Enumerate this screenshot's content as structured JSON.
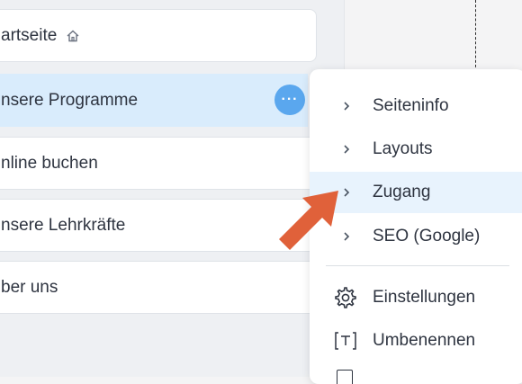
{
  "sidebar": {
    "pages": [
      {
        "label": "artseite",
        "home": true
      },
      {
        "label": "nsere Programme",
        "selected": true
      },
      {
        "label": "nline buchen"
      },
      {
        "label": "nsere Lehrkräfte"
      },
      {
        "label": "ber uns"
      }
    ],
    "more_label": "···"
  },
  "context_menu": {
    "items": [
      {
        "label": "Seiteninfo",
        "icon": "chevron-right-icon"
      },
      {
        "label": "Layouts",
        "icon": "chevron-right-icon"
      },
      {
        "label": "Zugang",
        "icon": "chevron-right-icon",
        "highlighted": true
      },
      {
        "label": "SEO (Google)",
        "icon": "chevron-right-icon"
      },
      {
        "label": "Einstellungen",
        "icon": "gear-icon"
      },
      {
        "label": "Umbenennen",
        "icon": "rename-icon"
      }
    ]
  },
  "colors": {
    "selected_bg": "#d9ecfc",
    "more_button": "#5aa7ee",
    "hover_bg": "#e8f3fd",
    "annotation_arrow": "#e0613a"
  }
}
